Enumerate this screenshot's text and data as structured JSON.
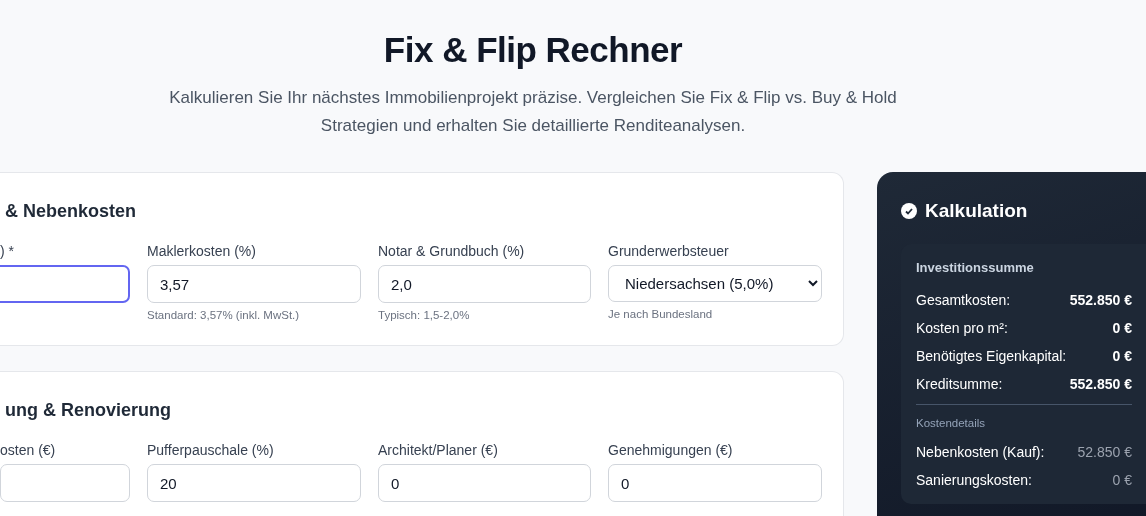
{
  "title": "Fix & Flip Rechner",
  "subtitle": "Kalkulieren Sie Ihr nächstes Immobilienprojekt präzise. Vergleichen Sie Fix & Flip vs. Buy & Hold Strategien und erhalten Sie detaillierte Renditeanalysen.",
  "sections": [
    {
      "title": "& Nebenkosten",
      "fields": [
        {
          "kind": "input",
          "label": ") *",
          "focused": true
        },
        {
          "kind": "input",
          "label": "Maklerkosten (%)",
          "value": "3,57",
          "hint": "Standard: 3,57% (inkl. MwSt.)",
          "focused": false
        },
        {
          "kind": "input",
          "label": "Notar & Grundbuch (%)",
          "value": "2,0",
          "hint": "Typisch: 1,5-2,0%",
          "focused": false
        },
        {
          "kind": "select",
          "label": "Grunderwerbsteuer",
          "value": "Niedersachsen (5,0%)",
          "hint": "Je nach Bundesland",
          "focused": false
        }
      ]
    },
    {
      "title": "ung & Renovierung",
      "fields": [
        {
          "kind": "input",
          "label": "osten (€)",
          "focused": false
        },
        {
          "kind": "input",
          "label": "Pufferpauschale (%)",
          "value": "20",
          "focused": false
        },
        {
          "kind": "input",
          "label": "Architekt/Planer (€)",
          "value": "0",
          "focused": false
        },
        {
          "kind": "input",
          "label": "Genehmigungen (€)",
          "value": "0",
          "focused": false
        }
      ]
    }
  ],
  "summary": {
    "title": "Kalkulation",
    "groups": [
      {
        "kind": "primary",
        "title": "Investitionssumme",
        "rows": [
          {
            "label": "Gesamtkosten:",
            "value": "552.850 €"
          },
          {
            "label": "Kosten pro m²:",
            "value": "0 €"
          },
          {
            "label": "Benötigtes Eigenkapital:",
            "value": "0 €"
          },
          {
            "label": "Kreditsumme:",
            "value": "552.850 €"
          }
        ]
      },
      {
        "kind": "secondary",
        "title": "Kostendetails",
        "rows": [
          {
            "label": "Nebenkosten (Kauf):",
            "value": "52.850 €"
          },
          {
            "label": "Sanierungskosten:",
            "value": "0 €"
          }
        ]
      }
    ]
  }
}
